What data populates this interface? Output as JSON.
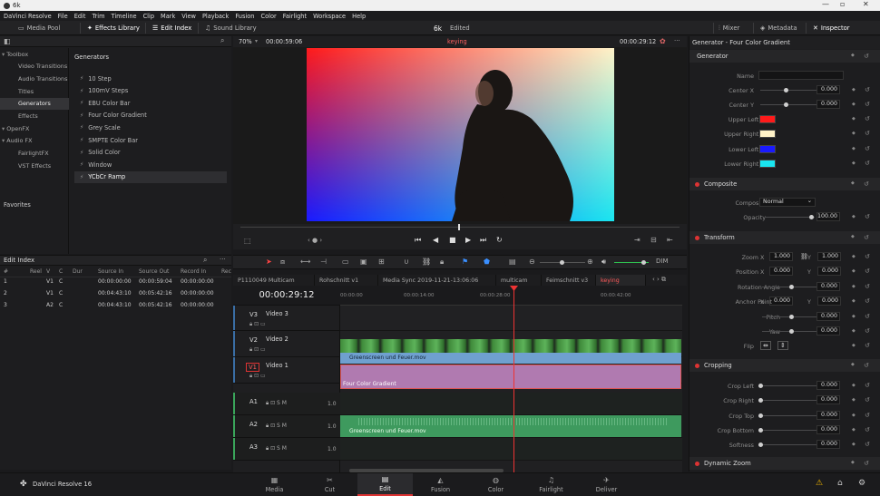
{
  "window": {
    "title": "6k"
  },
  "menu": [
    "DaVinci Resolve",
    "File",
    "Edit",
    "Trim",
    "Timeline",
    "Clip",
    "Mark",
    "View",
    "Playback",
    "Fusion",
    "Color",
    "Fairlight",
    "Workspace",
    "Help"
  ],
  "toolbar": {
    "media_pool": "Media Pool",
    "effects_library": "Effects Library",
    "edit_index": "Edit Index",
    "sound_library": "Sound Library",
    "project": "6k",
    "status": "Edited",
    "mixer": "Mixer",
    "metadata": "Metadata",
    "inspector": "Inspector"
  },
  "sidebar": {
    "categories": [
      {
        "label": "Toolbox",
        "level": 0
      },
      {
        "label": "Video Transitions",
        "level": 1
      },
      {
        "label": "Audio Transitions",
        "level": 1
      },
      {
        "label": "Titles",
        "level": 1
      },
      {
        "label": "Generators",
        "level": 1,
        "selected": true
      },
      {
        "label": "Effects",
        "level": 1
      },
      {
        "label": "OpenFX",
        "level": 0
      },
      {
        "label": "Audio FX",
        "level": 0
      },
      {
        "label": "FairlightFX",
        "level": 1
      },
      {
        "label": "VST Effects",
        "level": 1
      }
    ],
    "favorites": "Favorites"
  },
  "generators": {
    "header": "Generators",
    "items": [
      "10 Step",
      "100mV Steps",
      "EBU Color Bar",
      "Four Color Gradient",
      "Grey Scale",
      "SMPTE Color Bar",
      "Solid Color",
      "Window",
      "YCbCr Ramp"
    ],
    "selected_index": 8
  },
  "edit_index": {
    "title": "Edit Index",
    "columns": [
      "#",
      "Reel",
      "V",
      "C",
      "Dur",
      "Source In",
      "Source Out",
      "Record In",
      "Rec"
    ],
    "rows": [
      {
        "n": "1",
        "v": "V1",
        "c": "C",
        "src_in": "00:00:00:00",
        "src_out": "00:00:59:04",
        "rec_in": "00:00:00:00"
      },
      {
        "n": "2",
        "v": "V1",
        "c": "C",
        "src_in": "00:04:43:10",
        "src_out": "00:05:42:16",
        "rec_in": "00:00:00:00"
      },
      {
        "n": "3",
        "v": "A2",
        "c": "C",
        "src_in": "00:04:43:10",
        "src_out": "00:05:42:16",
        "rec_in": "00:00:00:00"
      }
    ]
  },
  "viewer": {
    "zoom": "70%",
    "source_tc": "00:00:59:06",
    "clip_name": "keying",
    "record_tc": "00:00:29:12"
  },
  "timeline": {
    "timecode": "00:00:29:12",
    "tabs": [
      "P1110049 Multicam",
      "Rohschnitt v1",
      "Media Sync 2019-11-21-13:06:06",
      "multicam",
      "Feimschnitt v3",
      "keying"
    ],
    "selected_tab": 5,
    "ruler": [
      "00:00:00",
      "00:00:14:00",
      "00:00:28:00",
      "00:00:42:00"
    ],
    "tracks": [
      {
        "id": "V3",
        "name": "Video 3"
      },
      {
        "id": "V2",
        "name": "Video 2"
      },
      {
        "id": "V1",
        "name": "Video 1"
      },
      {
        "id": "A1",
        "level": "1.0"
      },
      {
        "id": "A2",
        "level": "1.0"
      },
      {
        "id": "A3",
        "level": "1.0"
      }
    ],
    "clips": {
      "v2": "Greenscreen und Feuer.mov",
      "v1": "Four Color Gradient",
      "a2": "Greenscreen und Feuer.mov"
    }
  },
  "inspector": {
    "title": "Generator - Four Color Gradient",
    "generator": {
      "header": "Generator",
      "name_label": "Name",
      "center_x_label": "Center X",
      "center_x": "0.000",
      "center_y_label": "Center Y",
      "center_y": "0.000",
      "colors": [
        {
          "label": "Upper Left Color",
          "hex": "#ff1a1a"
        },
        {
          "label": "Upper Right Color",
          "hex": "#fff2c8"
        },
        {
          "label": "Lower Left Color",
          "hex": "#1a1aff"
        },
        {
          "label": "Lower Right Color",
          "hex": "#1ae6f0"
        }
      ]
    },
    "composite": {
      "header": "Composite",
      "mode_label": "Composite Mode",
      "mode": "Normal",
      "opacity_label": "Opacity",
      "opacity": "100.00"
    },
    "transform": {
      "header": "Transform",
      "zoom_label": "Zoom",
      "zoom_x": "1.000",
      "zoom_y": "1.000",
      "position_label": "Position",
      "pos_x": "0.000",
      "pos_y": "0.000",
      "rotation_label": "Rotation Angle",
      "rotation": "0.000",
      "anchor_label": "Anchor Point",
      "anchor_x": "0.000",
      "anchor_y": "0.000",
      "pitch_label": "Pitch",
      "pitch": "0.000",
      "yaw_label": "Yaw",
      "yaw": "0.000",
      "flip_label": "Flip",
      "x": "X",
      "y": "Y"
    },
    "cropping": {
      "header": "Cropping",
      "rows": [
        {
          "label": "Crop Left",
          "value": "0.000"
        },
        {
          "label": "Crop Right",
          "value": "0.000"
        },
        {
          "label": "Crop Top",
          "value": "0.000"
        },
        {
          "label": "Crop Bottom",
          "value": "0.000"
        },
        {
          "label": "Softness",
          "value": "0.000"
        }
      ]
    },
    "dynamic_zoom": {
      "header": "Dynamic Zoom"
    }
  },
  "pages": {
    "app": "DaVinci Resolve 16",
    "items": [
      "Media",
      "Cut",
      "Edit",
      "Fusion",
      "Color",
      "Fairlight",
      "Deliver"
    ],
    "selected": 2
  }
}
